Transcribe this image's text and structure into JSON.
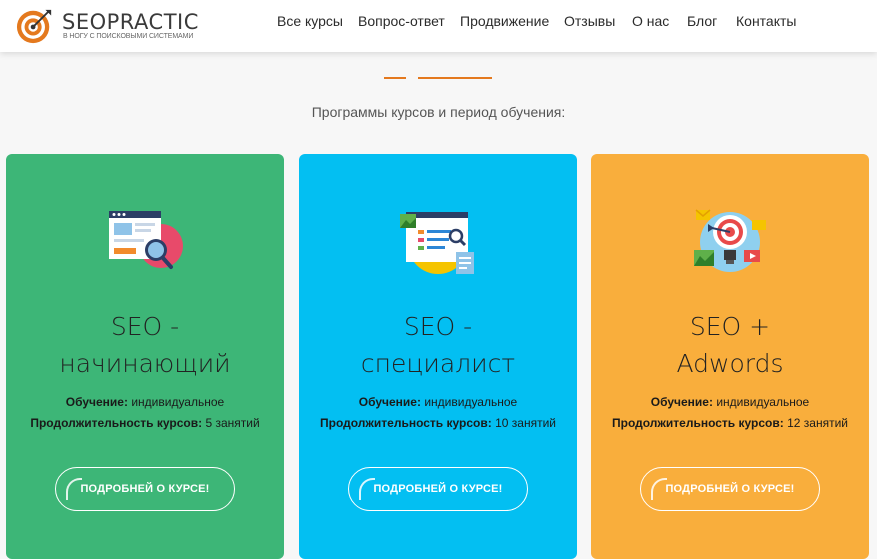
{
  "brand": {
    "name": "SEOPRACTIC",
    "tagline": "В НОГУ С ПОИСКОВЫМИ СИСТЕМАМИ"
  },
  "nav": {
    "items": [
      {
        "label": "Все курсы"
      },
      {
        "label": "Вопрос-ответ"
      },
      {
        "label": "Продвижение"
      },
      {
        "label": "Отзывы"
      },
      {
        "label": "О нас"
      },
      {
        "label": "Блог"
      },
      {
        "label": "Контакты"
      }
    ]
  },
  "section": {
    "subtitle": "Программы курсов и период обучения:"
  },
  "cards": [
    {
      "title_line1": "SEO -",
      "title_line2": "начинающий",
      "training_label": "Обучение:",
      "training_value": "индивидуальное",
      "duration_label": "Продолжительность курсов:",
      "duration_value": "5 занятий",
      "button_label": "ПОДРОБНЕЙ О КУРСЕ!",
      "icon": "magnifier-browser-icon",
      "color": "#3db677"
    },
    {
      "title_line1": "SEO -",
      "title_line2": "специалист",
      "training_label": "Обучение:",
      "training_value": "индивидуальное",
      "duration_label": "Продолжительность курсов:",
      "duration_value": "10 занятий",
      "button_label": "ПОДРОБНЕЙ О КУРСЕ!",
      "icon": "analytics-page-icon",
      "color": "#03bff2"
    },
    {
      "title_line1": "SEO +",
      "title_line2": "Adwords",
      "training_label": "Обучение:",
      "training_value": "индивидуальное",
      "duration_label": "Продолжительность курсов:",
      "duration_value": "12 занятий",
      "button_label": "ПОДРОБНЕЙ О КУРСЕ!",
      "icon": "target-marketing-icon",
      "color": "#f9ae3c"
    }
  ]
}
